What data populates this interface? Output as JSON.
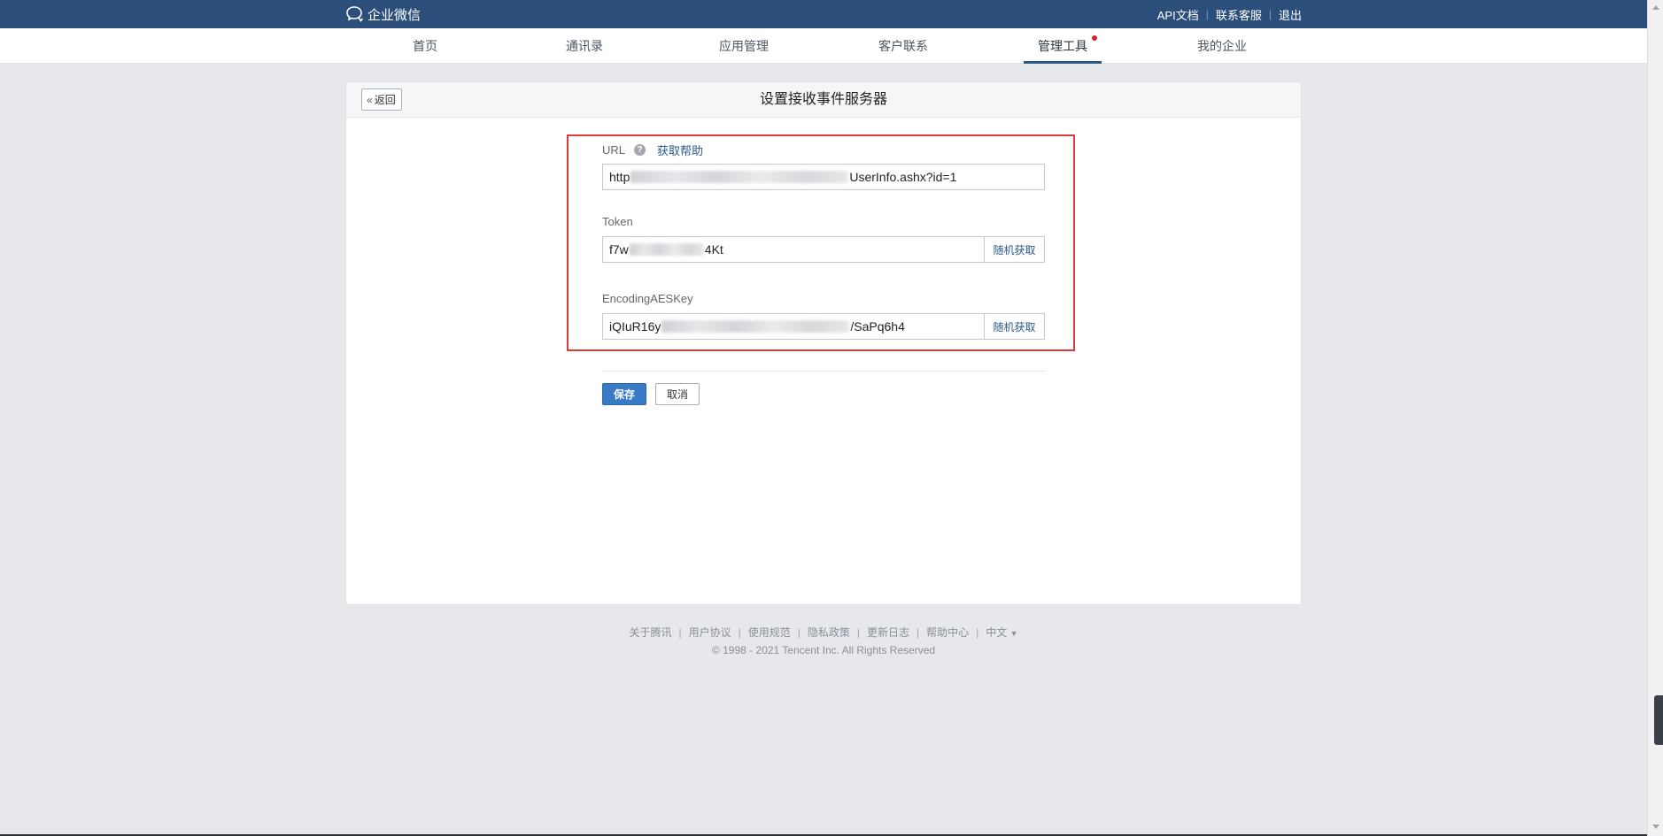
{
  "header": {
    "logo_text": "企业微信",
    "links": [
      "API文档",
      "联系客服",
      "退出"
    ]
  },
  "nav": {
    "items": [
      "首页",
      "通讯录",
      "应用管理",
      "客户联系",
      "管理工具",
      "我的企业"
    ],
    "active": "管理工具"
  },
  "card": {
    "back_label": "返回",
    "title": "设置接收事件服务器"
  },
  "form": {
    "url_label": "URL",
    "url_help_link": "获取帮助",
    "url_value_start": "http",
    "url_value_end": "UserInfo.ashx?id=1",
    "token_label": "Token",
    "token_value_start": "f7w",
    "token_value_end": "4Kt",
    "token_random_button": "随机获取",
    "aes_label": "EncodingAESKey",
    "aes_value_start": "iQIuR16y",
    "aes_value_end": "/SaPq6h4",
    "aes_random_button": "随机获取",
    "save_button": "保存",
    "cancel_button": "取消"
  },
  "footer": {
    "links": [
      "关于腾讯",
      "用户协议",
      "使用规范",
      "隐私政策",
      "更新日志",
      "帮助中心"
    ],
    "language": "中文",
    "copyright": "© 1998 - 2021 Tencent Inc. All Rights Reserved"
  },
  "colors": {
    "topbar": "#2b4f7a",
    "accent": "#2b5a8a",
    "save_button": "#3a7bc8",
    "highlight_border": "#e03b3b",
    "notification_dot": "#e02020"
  },
  "icons": {
    "logo": "wechat-work-logo-icon",
    "help": "question-circle-icon",
    "back": "double-chevron-left-icon",
    "language_dropdown": "caret-down-icon"
  }
}
